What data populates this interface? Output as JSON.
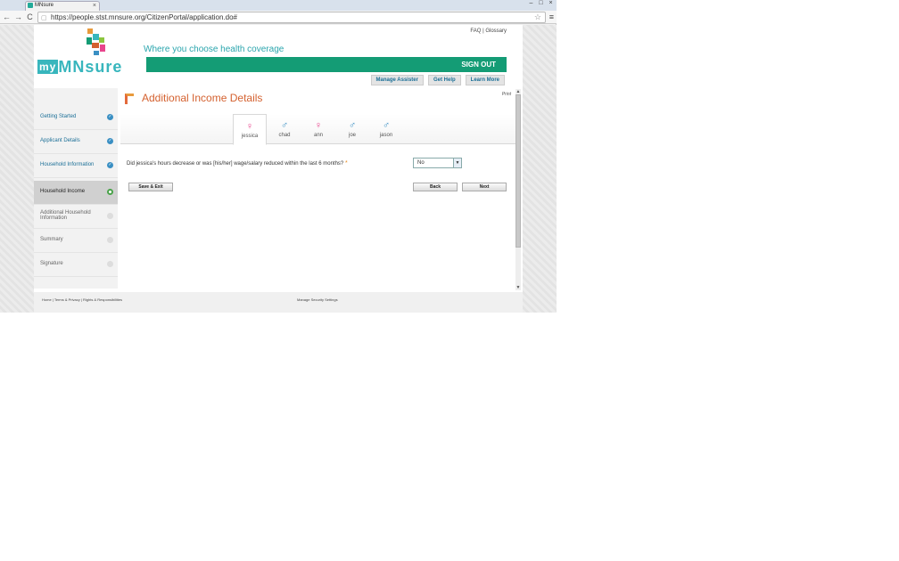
{
  "browser": {
    "tab_title": "MNsure",
    "tab_close": "×",
    "url": "https://people.stst.mnsure.org/CitizenPortal/application.do#",
    "back": "←",
    "forward": "→",
    "reload": "C",
    "star": "☆",
    "menu": "≡"
  },
  "header": {
    "faq_glossary": "FAQ | Glossary",
    "logo_my": "my",
    "logo_mn": "MN",
    "logo_sure": "sure",
    "tagline": "Where you choose health coverage",
    "sign_out": "SIGN OUT",
    "links": [
      "Manage Assister",
      "Get Help",
      "Learn More"
    ]
  },
  "sidebar": {
    "items": [
      {
        "label": "Getting Started",
        "status": "done"
      },
      {
        "label": "Applicant Details",
        "status": "done"
      },
      {
        "label": "Household Information",
        "status": "done"
      },
      {
        "label": "Household Income",
        "status": "current"
      },
      {
        "label": "Additional Household Information",
        "status": "todo"
      },
      {
        "label": "Summary",
        "status": "todo"
      },
      {
        "label": "Signature",
        "status": "todo"
      }
    ]
  },
  "main": {
    "title": "Additional Income Details",
    "print": "Print",
    "members": [
      {
        "name": "jessica",
        "color": "#e8458d",
        "selected": true
      },
      {
        "name": "chad",
        "color": "#3a8fc3"
      },
      {
        "name": "ann",
        "color": "#e8458d"
      },
      {
        "name": "joe",
        "color": "#3a8fc3"
      },
      {
        "name": "jason",
        "color": "#3a8fc3"
      }
    ],
    "question": "Did jessica's hours decrease or was [his/her] wage/salary reduced within the last 6 months?",
    "required_mark": "*",
    "answer": "No",
    "save_exit": "Save & Exit",
    "back": "Back",
    "next": "Next"
  },
  "footer": {
    "left": "Home | Terms & Privacy | Rights & Responsibilities",
    "center": "Manage Security Settings"
  },
  "colors": {
    "accent": "#149c75",
    "brand": "#38b6bd",
    "title": "#d4612f"
  }
}
